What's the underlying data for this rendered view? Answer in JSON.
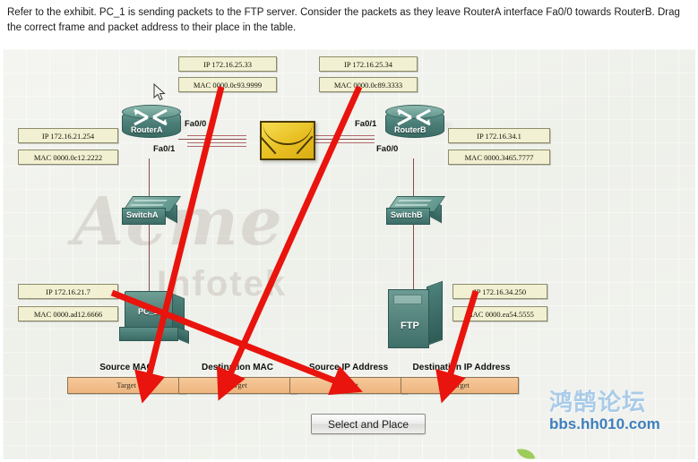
{
  "prompt": {
    "text": "Refer to the exhibit. PC_1 is sending packets to the FTP server. Consider the packets as they leave RouterA interface Fa0/0 towards RouterB. Drag the correct frame and packet address to their place in the table."
  },
  "exhibit": {
    "watermark": {
      "line1": "Acme",
      "line2": "Infotek"
    },
    "devices": [
      {
        "name": "RouterA",
        "label": "RouterA"
      },
      {
        "name": "RouterB",
        "label": "RouterB"
      },
      {
        "name": "SwitchA",
        "label": "SwitchA"
      },
      {
        "name": "SwitchB",
        "label": "SwitchB"
      },
      {
        "name": "PC_1",
        "label": "PC_1"
      },
      {
        "name": "FTP",
        "label": "FTP"
      }
    ],
    "interfaces": {
      "routera_fa00": "Fa0/0",
      "routera_fa01": "Fa0/1",
      "routerb_fa01": "Fa0/1",
      "routerb_fa00": "Fa0/0"
    },
    "labels": {
      "routera_wan_ip": "IP 172.16.25.33",
      "routera_wan_mac": "MAC 0000.0c93.9999",
      "routerb_wan_ip": "IP 172.16.25.34",
      "routerb_wan_mac": "MAC 0000.0c89.3333",
      "routera_lan_ip": "IP 172.16.21.254",
      "routera_lan_mac": "MAC 0000.0c12.2222",
      "routerb_lan_ip": "IP 172.16.34.1",
      "routerb_lan_mac": "MAC 0000.3465.7777",
      "pc_ip": "IP 172.16.21.7",
      "pc_mac": "MAC 0000.ad12.6666",
      "ftp_ip": "IP 172.16.34.250",
      "ftp_mac": "MAC 0000.ea54.5555"
    }
  },
  "answer_table": {
    "columns": [
      {
        "header": "Source MAC",
        "target": "Target"
      },
      {
        "header": "Destination MAC",
        "target": "Target"
      },
      {
        "header": "Source IP Address",
        "target": "Target"
      },
      {
        "header": "Destination IP Address",
        "target": "Target"
      }
    ]
  },
  "button": {
    "label": "Select and Place"
  },
  "brand": {
    "cn": "鸿鹄论坛",
    "url": "bbs.hh010.com"
  },
  "colors": {
    "arrow": "#e8140d",
    "device": "#4d817a",
    "label_bg": "#f2f0d2",
    "target_bg": "#f2be8c",
    "link": "#8b4a4a"
  }
}
